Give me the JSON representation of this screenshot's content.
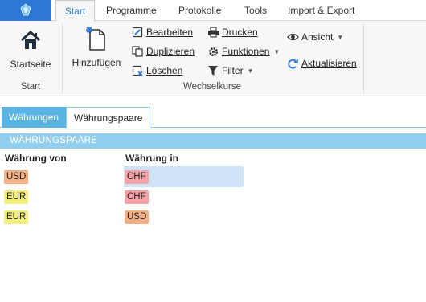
{
  "ribbon": {
    "tabs": [
      {
        "label": "Start",
        "active": true
      },
      {
        "label": "Programme",
        "active": false
      },
      {
        "label": "Protokolle",
        "active": false
      },
      {
        "label": "Tools",
        "active": false
      },
      {
        "label": "Import & Export",
        "active": false
      }
    ],
    "groups": {
      "start": {
        "label": "Start",
        "startseite": "Startseite"
      },
      "wechselkurse": {
        "label": "Wechselkurse",
        "hinzufuegen": "Hinzufügen",
        "bearbeiten": "Bearbeiten",
        "duplizieren": "Duplizieren",
        "loeschen": "Löschen",
        "drucken": "Drucken",
        "funktionen": "Funktionen",
        "filter": "Filter",
        "ansicht": "Ansicht",
        "aktualisieren": "Aktualisieren"
      }
    }
  },
  "content": {
    "tabs": [
      {
        "label": "Währungen",
        "active": false
      },
      {
        "label": "Währungspaare",
        "active": true
      }
    ],
    "section_title": "WÄHRUNGSPAARE",
    "columns": [
      "Währung von",
      "Währung in"
    ],
    "rows": [
      {
        "von": "USD",
        "in": "CHF",
        "selected": true
      },
      {
        "von": "EUR",
        "in": "CHF",
        "selected": false
      },
      {
        "von": "EUR",
        "in": "USD",
        "selected": false
      }
    ]
  },
  "currency_colors": {
    "USD": "#f5b183",
    "EUR": "#f3ef7e",
    "CHF": "#f5a3a9"
  },
  "colors": {
    "accent": "#2b79d5",
    "tab_inactive": "#59b4e4",
    "section_bar": "#92cfee",
    "selection": "#cfe4f7"
  }
}
